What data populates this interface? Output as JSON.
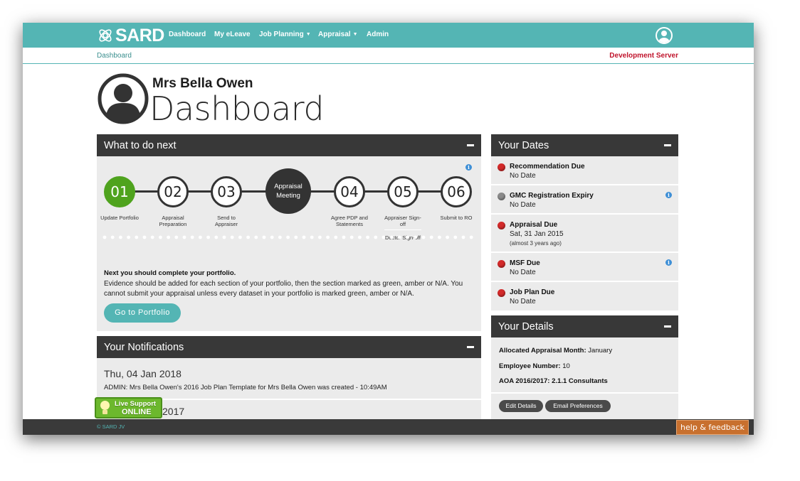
{
  "app": {
    "logo_text": "SARD",
    "nav": {
      "dashboard": "Dashboard",
      "eleave": "My eLeave",
      "job_planning": "Job Planning",
      "appraisal": "Appraisal",
      "admin": "Admin"
    },
    "breadcrumb": "Dashboard",
    "server_label": "Development Server",
    "accent_color": "#54b5b4"
  },
  "header": {
    "person_name": "Mrs Bella Owen",
    "page_title": "Dashboard"
  },
  "what_next": {
    "title": "What to do next",
    "steps": [
      {
        "number": "01",
        "label": "Update Portfolio",
        "state": "done"
      },
      {
        "number": "02",
        "label": "Appraisal Preparation",
        "state": "todo"
      },
      {
        "number": "03",
        "label": "Send to Appraiser",
        "state": "todo"
      },
      {
        "number": "04",
        "label": "Agree PDP and Statements",
        "state": "todo"
      },
      {
        "number": "05",
        "label": "Appraiser Sign-off",
        "sub_label": "Doctor Sign-off",
        "state": "todo"
      },
      {
        "number": "06",
        "label": "Submit to RO",
        "state": "todo"
      }
    ],
    "meeting_label_1": "Appraisal",
    "meeting_label_2": "Meeting",
    "next_heading": "Next you should complete your portfolio.",
    "next_body": "Evidence should be added for each section of your portfolio, then the section marked as green, amber or N/A. You cannot submit your appraisal unless every dataset in your portfolio is marked green, amber or N/A.",
    "portfolio_button": "Go to Portfolio"
  },
  "notifications": {
    "title": "Your Notifications",
    "items": [
      {
        "date": "Thu, 04 Jan 2018",
        "text": "ADMIN: Mrs Bella Owen's 2016 Job Plan Template for Mrs Bella Owen was created - 10:49AM"
      }
    ],
    "partial_date": "2017"
  },
  "live_support": {
    "line1": "Live Support",
    "line2": "ONLINE"
  },
  "dates": {
    "title": "Your Dates",
    "items": [
      {
        "title": "Recommendation Due",
        "value": "No Date",
        "status": "red"
      },
      {
        "title": "GMC Registration Expiry",
        "value": "No Date",
        "status": "grey"
      },
      {
        "title": "Appraisal Due",
        "value": "Sat, 31 Jan 2015",
        "note": "(almost 3 years ago)",
        "status": "red"
      },
      {
        "title": "MSF Due",
        "value": "No Date",
        "status": "red"
      },
      {
        "title": "Job Plan Due",
        "value": "No Date",
        "status": "red"
      }
    ]
  },
  "details": {
    "title": "Your Details",
    "month_label": "Allocated Appraisal Month:",
    "month_value": "January",
    "employee_label": "Employee Number:",
    "employee_value": "10",
    "aoa_label": "AOA 2016/2017:",
    "aoa_value": "2.1.1 Consultants",
    "edit_button": "Edit Details",
    "email_button": "Email Preferences"
  },
  "footer": {
    "copyright": "© SARD JV",
    "help_button": "help & feedback"
  }
}
